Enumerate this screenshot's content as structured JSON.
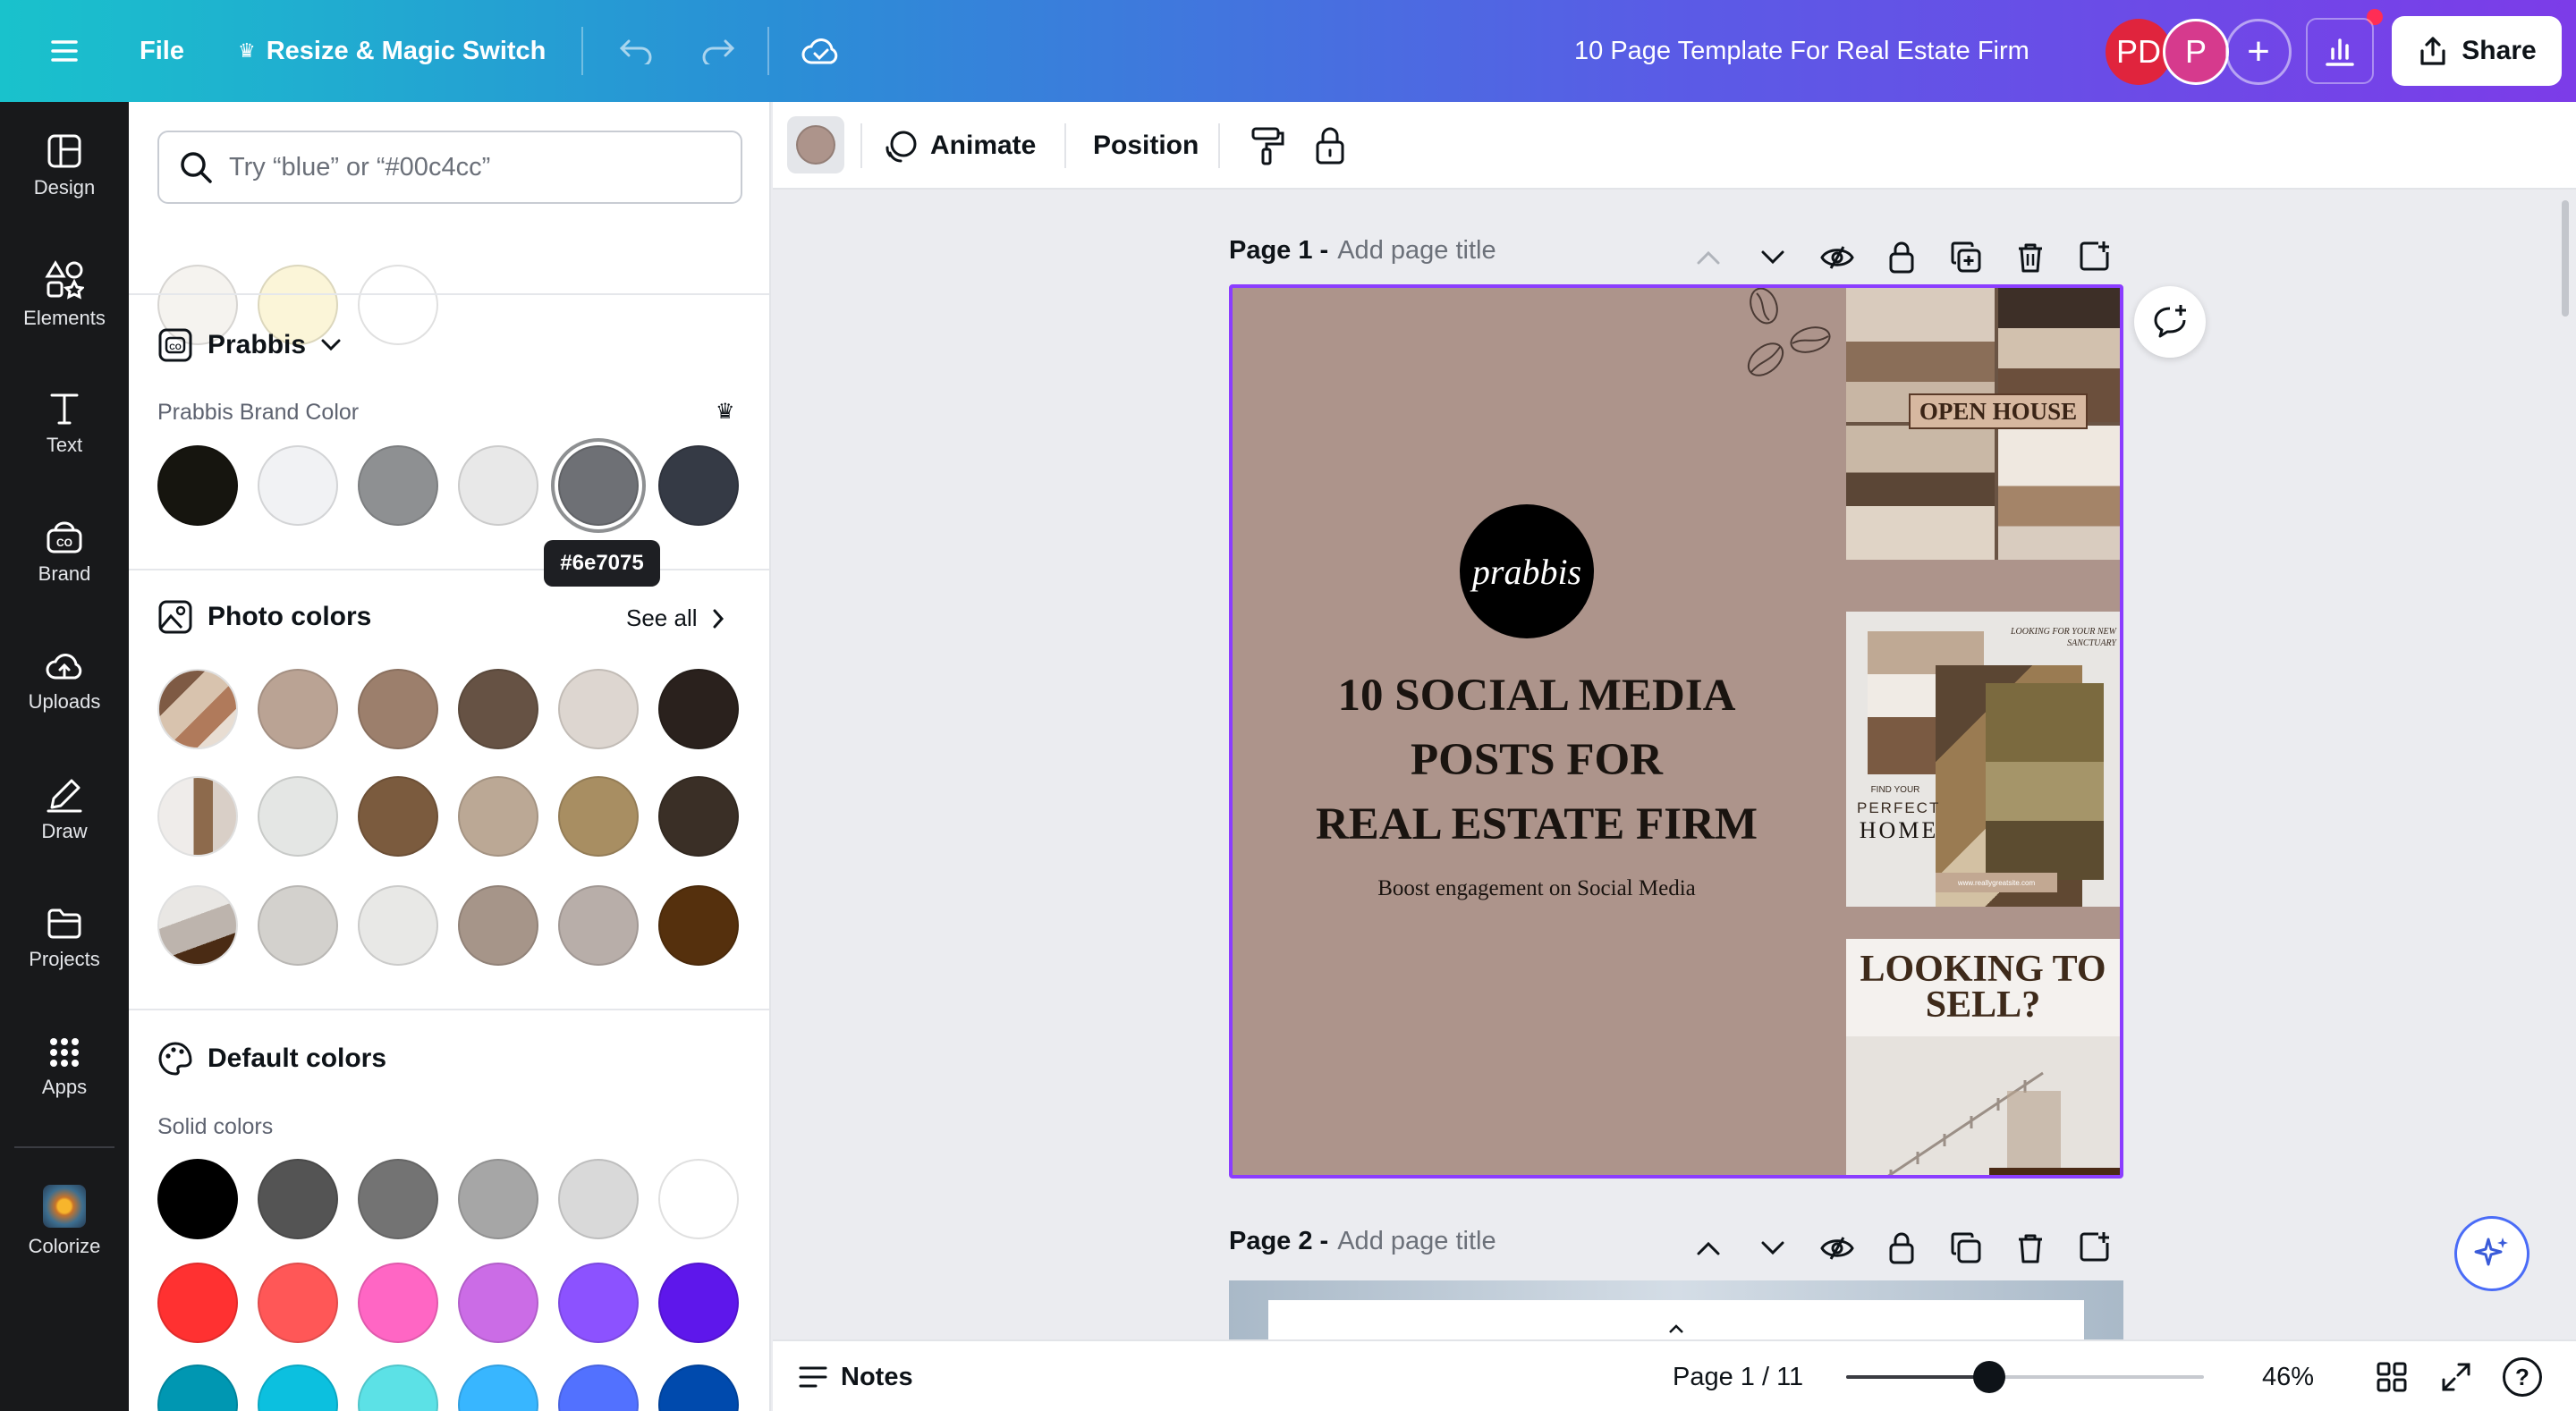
{
  "topbar": {
    "file_label": "File",
    "resize_label": "Resize & Magic Switch",
    "doc_title": "10 Page Template For Real Estate Firm",
    "avatar_1": "PD",
    "avatar_2": "P",
    "share_label": "Share"
  },
  "rail": {
    "items": [
      {
        "label": "Design",
        "icon": "design-icon"
      },
      {
        "label": "Elements",
        "icon": "elements-icon"
      },
      {
        "label": "Text",
        "icon": "text-icon"
      },
      {
        "label": "Brand",
        "icon": "brand-icon"
      },
      {
        "label": "Uploads",
        "icon": "uploads-icon"
      },
      {
        "label": "Draw",
        "icon": "draw-icon"
      },
      {
        "label": "Projects",
        "icon": "projects-icon"
      },
      {
        "label": "Apps",
        "icon": "apps-icon"
      },
      {
        "label": "Colorize",
        "icon": "colorize-icon"
      }
    ]
  },
  "panel": {
    "search_placeholder": "Try “blue” or “#00c4cc”",
    "recent_colors": [
      "#f5f3ef",
      "#fbf5d8",
      "#ffffff"
    ],
    "brand_kit_name": "Prabbis",
    "brand_color_label": "Prabbis Brand Color",
    "brand_colors": [
      "#16150f",
      "#f1f2f4",
      "#8e9092",
      "#e8e8e8",
      "#6e7075",
      "#353a45"
    ],
    "tooltip": "#6e7075",
    "photo_colors_title": "Photo colors",
    "see_all": "See all",
    "photo_rows": [
      [
        "#baa394",
        "#9c7f6c",
        "#665244",
        "#ddd6d0",
        "#2a211d"
      ],
      [
        "#e4e6e4",
        "#7b5b3e",
        "#bba895",
        "#a88e62",
        "#3a2f26"
      ],
      [
        "#d3d1cd",
        "#e8e8e6",
        "#a69589",
        "#b8aea9",
        "#55300d"
      ]
    ],
    "default_colors_title": "Default colors",
    "solid_colors_label": "Solid colors",
    "solid_rows": [
      [
        "#000000",
        "#545454",
        "#737373",
        "#a6a6a6",
        "#d9d9d9",
        "#ffffff"
      ],
      [
        "#ff3131",
        "#ff5757",
        "#ff66c4",
        "#cb6ce6",
        "#8c52ff",
        "#5e17eb"
      ],
      [
        "#0097b2",
        "#0cc0df",
        "#5ce1e6",
        "#38b6ff",
        "#5271ff",
        "#004aad"
      ]
    ]
  },
  "toolbar": {
    "current_color": "#ad948b",
    "animate_label": "Animate",
    "position_label": "Position"
  },
  "pages": {
    "page1_title": "Page 1 -",
    "page2_title": "Page 2 -",
    "add_title_placeholder": "Add page title"
  },
  "design": {
    "logo_text": "prabbis",
    "headline_1": "10 SOCIAL MEDIA",
    "headline_2": "POSTS FOR",
    "headline_3": "REAL ESTATE FIRM",
    "subline": "Boost engagement on Social Media",
    "thumb1_banner": "OPEN HOUSE",
    "thumb2_looking": "LOOKING FOR YOUR NEW SANCTUARY",
    "thumb2_find": "FIND YOUR",
    "thumb2_perfect": "PERFECT",
    "thumb2_home": "HOME",
    "thumb2_url": "www.reallygreatsite.com",
    "thumb3_title_1": "LOOKING TO",
    "thumb3_title_2": "SELL?"
  },
  "footer": {
    "notes_label": "Notes",
    "page_indicator": "Page 1 / 11",
    "zoom_level": "46%",
    "zoom_fraction": 0.4
  }
}
